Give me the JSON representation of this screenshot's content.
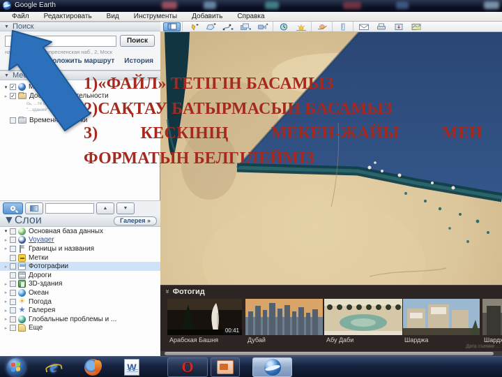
{
  "window": {
    "title": "Google Earth"
  },
  "menu": {
    "items": [
      {
        "label": "Файл"
      },
      {
        "label": "Редактировать"
      },
      {
        "label": "Вид"
      },
      {
        "label": "Инструменты"
      },
      {
        "label": "Добавить"
      },
      {
        "label": "Справка"
      }
    ]
  },
  "search_panel": {
    "title": "Поиск",
    "input_value": "",
    "button_label": "Поиск",
    "hint": "например: Краснопресненская наб., 2, Моск",
    "route_link": "Проложить маршрут",
    "history_link": "История"
  },
  "places_panel": {
    "title": "Места",
    "items": [
      {
        "label": "Мои метки",
        "checked": "✓"
      },
      {
        "label": "Достопримечательности",
        "checked": "✓"
      },
      {
        "label": "Временные метки",
        "checked": ""
      }
    ],
    "description_fragments": [
      "сь, ...те слой",
      "\"...здания\" вкл..."
    ]
  },
  "layers_panel": {
    "title": "Слои",
    "gallery_button": "Галерея »",
    "items": [
      {
        "label": "Основная база данных"
      },
      {
        "label": "Voyager"
      },
      {
        "label": "Границы и названия"
      },
      {
        "label": "Метки"
      },
      {
        "label": "Фотографии"
      },
      {
        "label": "Дороги"
      },
      {
        "label": "3D-здания"
      },
      {
        "label": "Океан"
      },
      {
        "label": "Погода"
      },
      {
        "label": "Галерея"
      },
      {
        "label": "Глобальные проблемы и ..."
      },
      {
        "label": "Еще"
      }
    ]
  },
  "toolbar": {
    "buttons": [
      "sidebar-toggle",
      "add-placemark",
      "add-polygon",
      "add-path",
      "add-image-overlay",
      "record-tour",
      "historical-imagery",
      "sunlight",
      "planets",
      "ruler",
      "email",
      "print",
      "save-image",
      "view-in-maps"
    ]
  },
  "annotation": {
    "line1": "1)«ФАЙЛ» ТЕТІГІН БАСАМЫЗ",
    "line2": "2)САҚТАУ БАТЫРМАСЫН БАСАМЫЗ",
    "line3": "3) КЕСКІНІҢ МЕКЕН-ЖАЙЫ МЕН",
    "line4": "ФОРМАТЫН БЕЛГІЛЕЙМІЗ"
  },
  "photo_panel": {
    "title": "Фотогид",
    "photos": [
      {
        "caption": "Арабская Башня",
        "badge": "00:41"
      },
      {
        "caption": "Дубай"
      },
      {
        "caption": "Абу Даби"
      },
      {
        "caption": "Шарджа"
      },
      {
        "caption": "Шарджа"
      }
    ],
    "attribution": "Дата съемки ..."
  },
  "glyphs": {
    "panel_arrow": "▼",
    "tree_collapsed": "▸",
    "tree_expanded": "▾",
    "chevrons": "»",
    "up_arrow": "▲",
    "down_arrow": "▼",
    "sun": "☀",
    "star": "★",
    "ie_letter": "e",
    "word_letter": "W",
    "opera_letter": "O"
  },
  "colors": {
    "annotation_red": "#a5291f",
    "arrow_blue": "#2c6fba",
    "selection_blue": "#cfe3f8",
    "sea": "#2e4d7b",
    "sand": "#d9c498",
    "taskbar": "#16233f"
  }
}
